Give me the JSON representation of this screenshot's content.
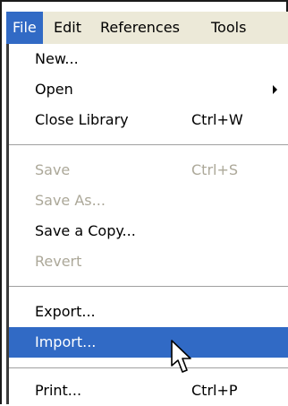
{
  "menubar": {
    "items": [
      "File",
      "Edit",
      "References",
      "Tools"
    ]
  },
  "menu": {
    "new": "New...",
    "open": "Open",
    "close_library": "Close Library",
    "close_library_shortcut": "Ctrl+W",
    "save": "Save",
    "save_shortcut": "Ctrl+S",
    "save_as": "Save As...",
    "save_copy": "Save a Copy...",
    "revert": "Revert",
    "export": "Export...",
    "import": "Import...",
    "print": "Print...",
    "print_shortcut": "Ctrl+P"
  },
  "colors": {
    "highlight": "#316ac5",
    "disabled_text": "#aca899",
    "menubar_bg": "#ece9d8"
  },
  "icons": {
    "cursor": "arrow-cursor-icon",
    "submenu": "submenu-arrow-icon"
  }
}
